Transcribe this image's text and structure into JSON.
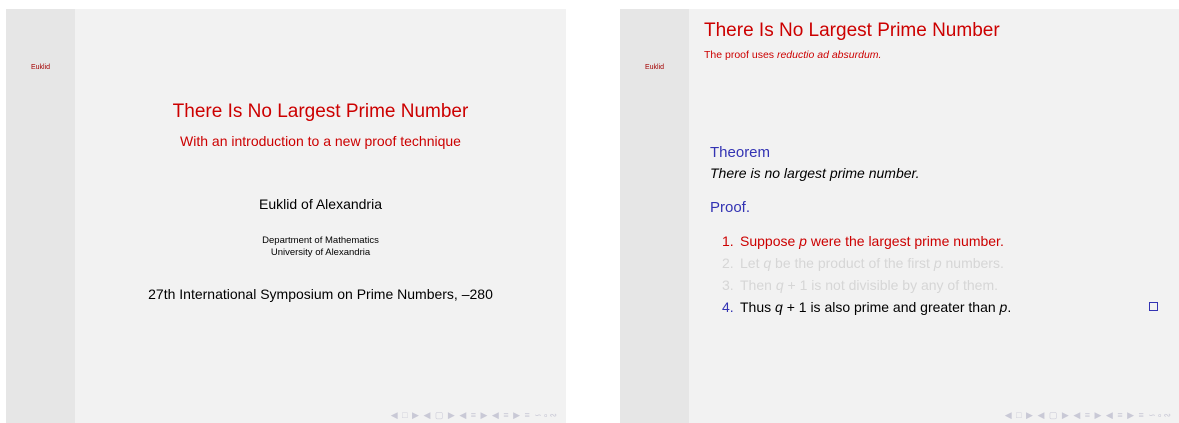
{
  "slide1": {
    "sidebar_nav": "Euklid",
    "title": "There Is No Largest Prime Number",
    "subtitle": "With an introduction to a new proof technique",
    "author": "Euklid of Alexandria",
    "department": "Department of Mathematics",
    "university": "University of Alexandria",
    "date": "27th International Symposium on Prime Numbers, –280",
    "nav_symbols": "◀ □ ▶ ◀ ▢ ▶ ◀ ≡ ▶ ◀ ≡ ▶   ≡   ∽∘∾"
  },
  "slide2": {
    "sidebar_nav": "Euklid",
    "frame_title": "There Is No Largest Prime Number",
    "frame_subtitle_prefix": "The proof uses ",
    "frame_subtitle_em": "reductio ad absurdum.",
    "theorem_label": "Theorem",
    "theorem_text": "There is no largest prime number.",
    "proof_label": "Proof.",
    "steps": [
      {
        "num": "1.",
        "pre": "Suppose ",
        "var": "p",
        "post": " were the largest prime number.",
        "state": "active"
      },
      {
        "num": "2.",
        "pre": "Let ",
        "var": "q",
        "post": " be the product of the first ",
        "var2": "p",
        "post2": " numbers.",
        "state": "dim"
      },
      {
        "num": "3.",
        "pre": "Then ",
        "var": "q",
        "post": " + 1 is not divisible by any of them.",
        "state": "dim"
      },
      {
        "num": "4.",
        "pre": "Thus ",
        "var": "q",
        "post": " + 1 is also prime and greater than ",
        "var2": "p",
        "post2": ".",
        "state": "current"
      }
    ],
    "nav_symbols": "◀ □ ▶ ◀ ▢ ▶ ◀ ≡ ▶ ◀ ≡ ▶   ≡   ∽∘∾"
  }
}
